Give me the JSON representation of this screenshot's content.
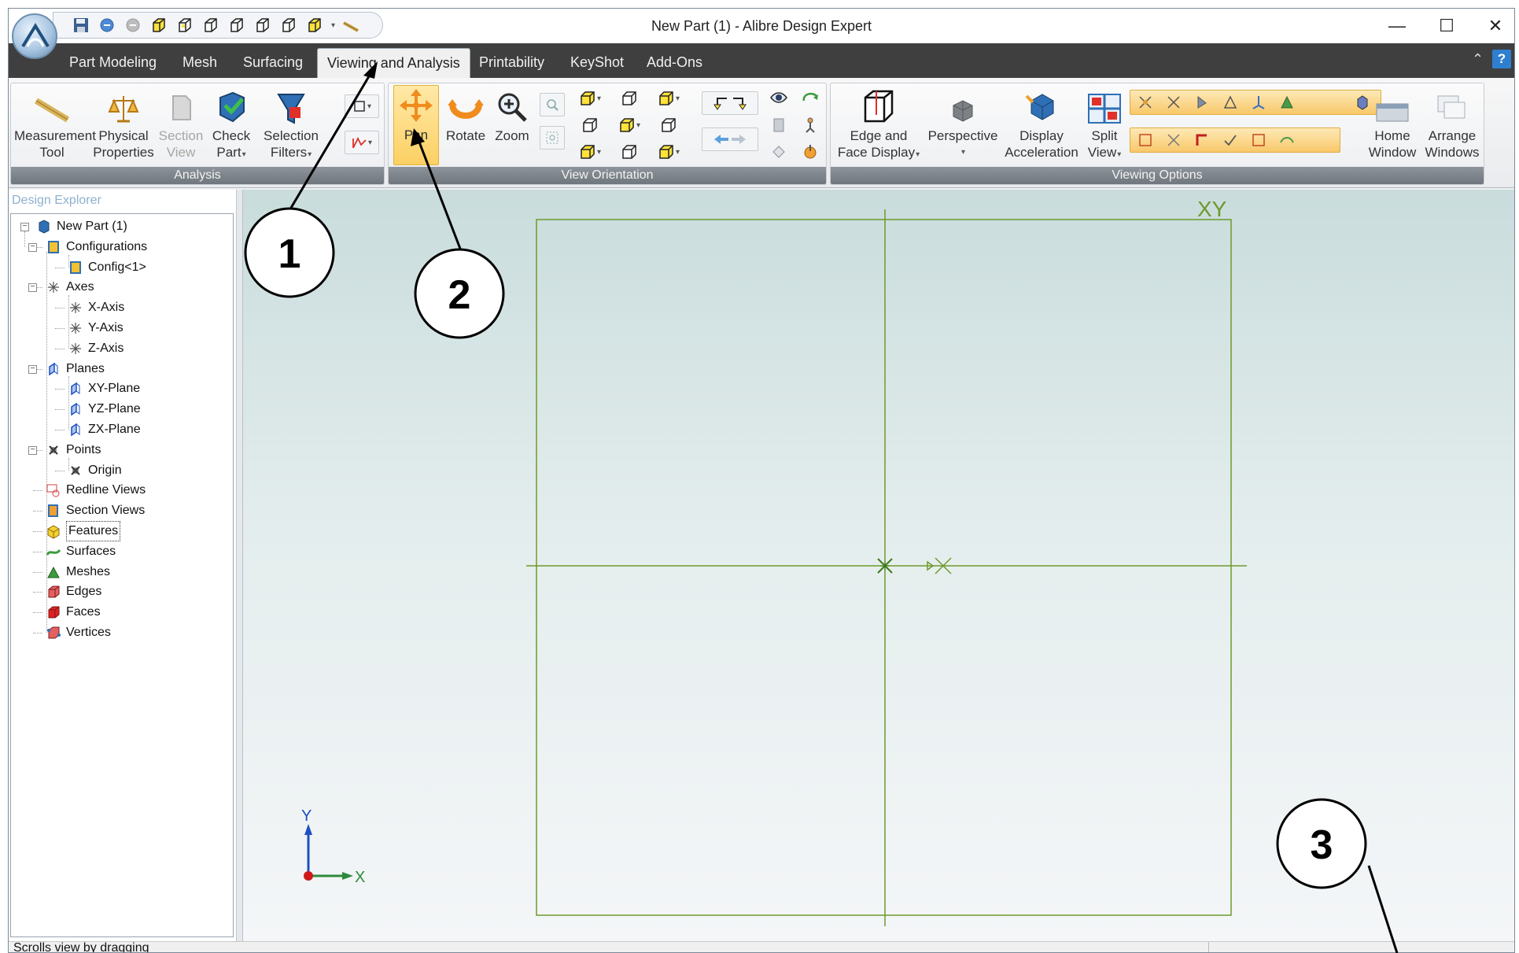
{
  "window": {
    "title": "New Part (1) - Alibre Design Expert",
    "controls": {
      "minimize": "—",
      "maximize": "☐",
      "close": "✕"
    }
  },
  "quick_access": [
    "save-icon",
    "undo-icon",
    "redo-icon",
    "cube-view-icon",
    "cube-view-icon",
    "cube-view-icon",
    "cube-view-icon",
    "cube-view-icon",
    "cube-view-icon",
    "cube-view-icon",
    "measure-icon"
  ],
  "tabs": [
    "Part Modeling",
    "Mesh",
    "Surfacing",
    "Viewing and Analysis",
    "Printability",
    "KeyShot",
    "Add-Ons"
  ],
  "active_tab": "Viewing and Analysis",
  "ribbon": {
    "analysis": {
      "label": "Analysis",
      "measurement_tool": [
        "Measurement",
        "Tool"
      ],
      "physical_properties": [
        "Physical",
        "Properties"
      ],
      "section_view": [
        "Section",
        "View"
      ],
      "check_part": [
        "Check",
        "Part"
      ],
      "selection_filters": [
        "Selection",
        "Filters"
      ]
    },
    "view_orientation": {
      "label": "View Orientation",
      "pan": "Pan",
      "rotate": "Rotate",
      "zoom": "Zoom"
    },
    "viewing_options": {
      "label": "Viewing Options",
      "edge_face": [
        "Edge and",
        "Face Display"
      ],
      "perspective": "Perspective",
      "display_accel": [
        "Display",
        "Acceleration"
      ],
      "split_view": [
        "Split",
        "View"
      ],
      "home_window": [
        "Home",
        "Window"
      ],
      "arrange_windows": [
        "Arrange",
        "Windows"
      ]
    }
  },
  "explorer": {
    "title": "Design Explorer",
    "nodes": [
      {
        "label": "New Part (1)",
        "icon": "part-icon"
      },
      {
        "label": "Configurations",
        "icon": "configurations-icon"
      },
      {
        "label": "Config<1>",
        "icon": "config-icon"
      },
      {
        "label": "Axes",
        "icon": "axes-icon"
      },
      {
        "label": "X-Axis",
        "icon": "axis-icon"
      },
      {
        "label": "Y-Axis",
        "icon": "axis-icon"
      },
      {
        "label": "Z-Axis",
        "icon": "axis-icon"
      },
      {
        "label": "Planes",
        "icon": "planes-icon"
      },
      {
        "label": "XY-Plane",
        "icon": "plane-icon"
      },
      {
        "label": "YZ-Plane",
        "icon": "plane-icon"
      },
      {
        "label": "ZX-Plane",
        "icon": "plane-icon"
      },
      {
        "label": "Points",
        "icon": "points-icon"
      },
      {
        "label": "Origin",
        "icon": "point-icon"
      },
      {
        "label": "Redline Views",
        "icon": "redline-icon"
      },
      {
        "label": "Section Views",
        "icon": "section-views-icon"
      },
      {
        "label": "Features",
        "icon": "features-icon"
      },
      {
        "label": "Surfaces",
        "icon": "surfaces-icon"
      },
      {
        "label": "Meshes",
        "icon": "meshes-icon"
      },
      {
        "label": "Edges",
        "icon": "edges-icon"
      },
      {
        "label": "Faces",
        "icon": "faces-icon"
      },
      {
        "label": "Vertices",
        "icon": "vertices-icon"
      }
    ],
    "selected": "Features"
  },
  "viewport": {
    "plane_label": "XY",
    "triad": {
      "y": "Y",
      "x": "X"
    },
    "colors": {
      "sketch": "#6e9a2c",
      "triad_y": "#1d4fc2",
      "triad_x": "#2c8a3a",
      "triad_z": "#d01818"
    }
  },
  "status": {
    "text": "Scrolls view by dragging"
  },
  "callouts": [
    "1",
    "2",
    "3"
  ]
}
